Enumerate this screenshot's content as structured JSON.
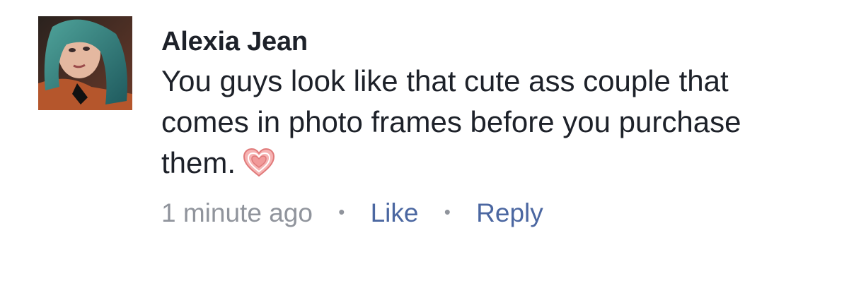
{
  "comment": {
    "author": "Alexia Jean",
    "text": "You guys look like that cute ass couple that comes in photo frames before you purchase them.",
    "emoji": "heart-icon",
    "timestamp": "1 minute ago",
    "like_label": "Like",
    "reply_label": "Reply",
    "separator": "•"
  },
  "colors": {
    "author": "#1d2129",
    "text": "#1d2129",
    "meta": "#90949c",
    "link": "#4b67a1",
    "heart": "#f08a8a"
  }
}
